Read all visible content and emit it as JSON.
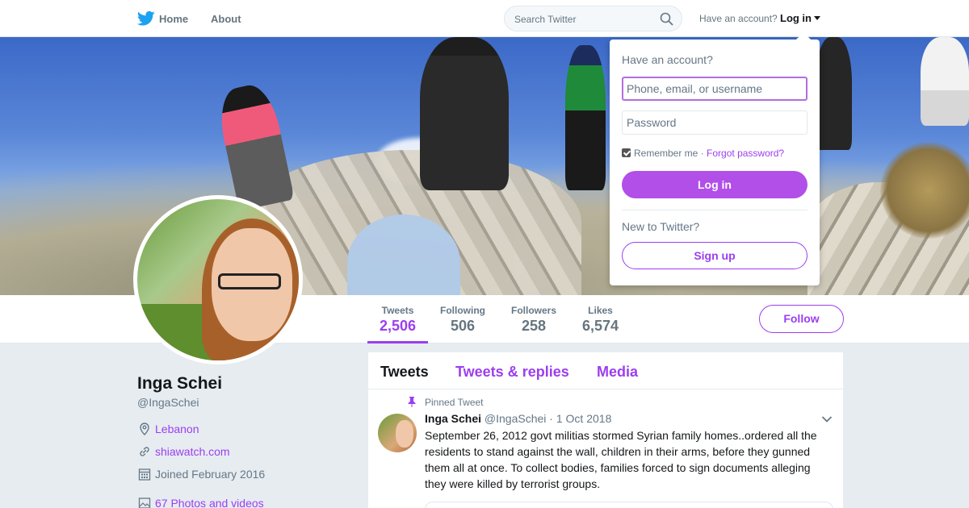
{
  "nav": {
    "home_label": "Home",
    "about_label": "About",
    "search_placeholder": "Search Twitter",
    "have_account_text": "Have an account?",
    "login_label": "Log in"
  },
  "profile": {
    "name": "Inga Schei",
    "handle": "@IngaSchei",
    "location": "Lebanon",
    "website": "shiawatch.com",
    "joined": "Joined February 2016",
    "photos_videos": "67 Photos and videos"
  },
  "stats": [
    {
      "label": "Tweets",
      "value": "2,506"
    },
    {
      "label": "Following",
      "value": "506"
    },
    {
      "label": "Followers",
      "value": "258"
    },
    {
      "label": "Likes",
      "value": "6,574"
    }
  ],
  "follow_label": "Follow",
  "timeline": {
    "tabs": [
      "Tweets",
      "Tweets & replies",
      "Media"
    ],
    "pinned_label": "Pinned Tweet",
    "tweet": {
      "name": "Inga Schei",
      "handle": "@IngaSchei",
      "date": "1 Oct 2018",
      "text": "September 26, 2012 govt militias stormed Syrian family homes..ordered all the residents to stand against the wall,  children in their arms, before they gunned them all at once. To collect bodies, families forced to sign documents alleging they were killed by terrorist groups."
    }
  },
  "login_dropdown": {
    "title": "Have an account?",
    "username_placeholder": "Phone, email, or username",
    "password_placeholder": "Password",
    "remember_label": "Remember me",
    "separator": "·",
    "forgot_label": "Forgot password?",
    "login_button": "Log in",
    "new_text": "New to Twitter?",
    "signup_button": "Sign up"
  },
  "colors": {
    "accent": "#9c3ef0",
    "login_button": "#b14fe8",
    "twitter_blue": "#1da1f2"
  }
}
